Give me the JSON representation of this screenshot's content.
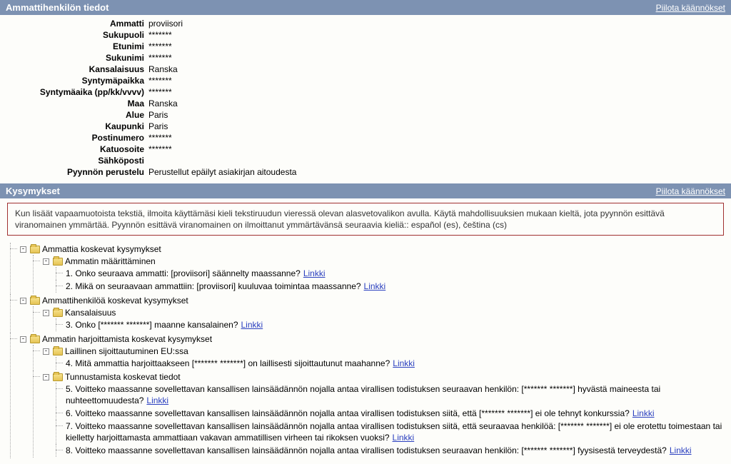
{
  "section1": {
    "title": "Ammattihenkilön tiedot",
    "hide_link": "Piilota käännökset",
    "fields": [
      {
        "label": "Ammatti",
        "value": "proviisori"
      },
      {
        "label": "Sukupuoli",
        "value": "*******"
      },
      {
        "label": "Etunimi",
        "value": "*******"
      },
      {
        "label": "Sukunimi",
        "value": "*******"
      },
      {
        "label": "Kansalaisuus",
        "value": "Ranska"
      },
      {
        "label": "Syntymäpaikka",
        "value": "*******"
      },
      {
        "label": "Syntymäaika (pp/kk/vvvv)",
        "value": "*******"
      },
      {
        "label": "Maa",
        "value": "Ranska"
      },
      {
        "label": "Alue",
        "value": "Paris"
      },
      {
        "label": "Kaupunki",
        "value": "Paris"
      },
      {
        "label": "Postinumero",
        "value": "*******"
      },
      {
        "label": "Katuosoite",
        "value": "*******"
      },
      {
        "label": "Sähköposti",
        "value": ""
      },
      {
        "label": "Pyynnön perustelu",
        "value": "Perustellut epäilyt asiakirjan aitoudesta"
      }
    ]
  },
  "section2": {
    "title": "Kysymykset",
    "hide_link": "Piilota käännökset",
    "notice": "Kun lisäät vapaamuotoista tekstiä, ilmoita käyttämäsi kieli tekstiruudun vieressä olevan alasvetovalikon avulla. Käytä mahdollisuuksien mukaan kieltä, jota pyynnön esittävä viranomainen ymmärtää. Pyynnön esittävä viranomainen on ilmoittanut ymmärtävänsä seuraavia kieliä:: español (es), čeština (cs)"
  },
  "tree": {
    "link_label": "Linkki",
    "nodes": [
      {
        "label": "Ammattia koskevat kysymykset",
        "children": [
          {
            "label": "Ammatin määrittäminen",
            "leaves": [
              {
                "text": "1. Onko seuraava ammatti: [proviisori] säännelty maassanne?",
                "link": true
              },
              {
                "text": "2. Mikä on seuraavaan ammattiin: [proviisori] kuuluvaa toimintaa maassanne?",
                "link": true
              }
            ]
          }
        ]
      },
      {
        "label": "Ammattihenkilöä koskevat kysymykset",
        "children": [
          {
            "label": "Kansalaisuus",
            "leaves": [
              {
                "text": "3. Onko [******* *******] maanne kansalainen?",
                "link": true
              }
            ]
          }
        ]
      },
      {
        "label": "Ammatin harjoittamista koskevat kysymykset",
        "children": [
          {
            "label": "Laillinen sijoittautuminen EU:ssa",
            "leaves": [
              {
                "text": "4. Mitä ammattia harjoittaakseen [******* *******] on laillisesti sijoittautunut maahanne?",
                "link": true
              }
            ]
          },
          {
            "label": "Tunnustamista koskevat tiedot",
            "leaves": [
              {
                "text": "5. Voitteko maassanne sovellettavan kansallisen lainsäädännön nojalla antaa virallisen todistuksen seuraavan henkilön: [******* *******] hyvästä maineesta tai nuhteettomuudesta?",
                "link": true
              },
              {
                "text": "6. Voitteko maassanne sovellettavan kansallisen lainsäädännön nojalla antaa virallisen todistuksen siitä, että [******* *******] ei ole tehnyt konkurssia?",
                "link": true
              },
              {
                "text": "7. Voitteko maassanne sovellettavan kansallisen lainsäädännön nojalla antaa virallisen todistuksen siitä, että seuraavaa henkilöä: [******* *******] ei ole erotettu toimestaan tai kielletty harjoittamasta ammattiaan vakavan ammatillisen virheen tai rikoksen vuoksi?",
                "link": true
              },
              {
                "text": "8. Voitteko maassanne sovellettavan kansallisen lainsäädännön nojalla antaa virallisen todistuksen seuraavan henkilön: [******* *******] fyysisestä terveydestä?",
                "link": true
              }
            ]
          }
        ]
      }
    ]
  }
}
